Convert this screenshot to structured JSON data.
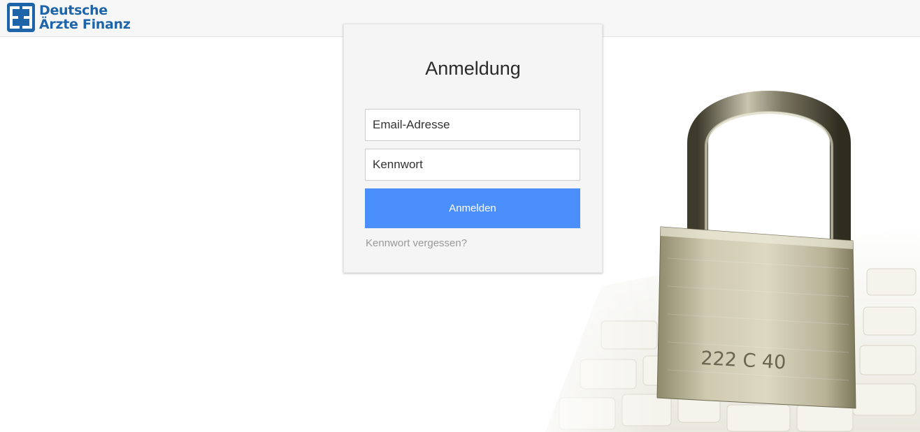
{
  "brand": {
    "line1": "Deutsche",
    "line2": "Ärzte Finanz",
    "color": "#1d64a8"
  },
  "login": {
    "title": "Anmeldung",
    "email_placeholder": "Email-Adresse",
    "password_placeholder": "Kennwort",
    "submit_label": "Anmelden",
    "forgot_label": "Kennwort vergessen?",
    "button_color": "#4a8ffb"
  },
  "hero": {
    "icon": "padlock-on-keyboard",
    "padlock_code": "222 C 40"
  }
}
